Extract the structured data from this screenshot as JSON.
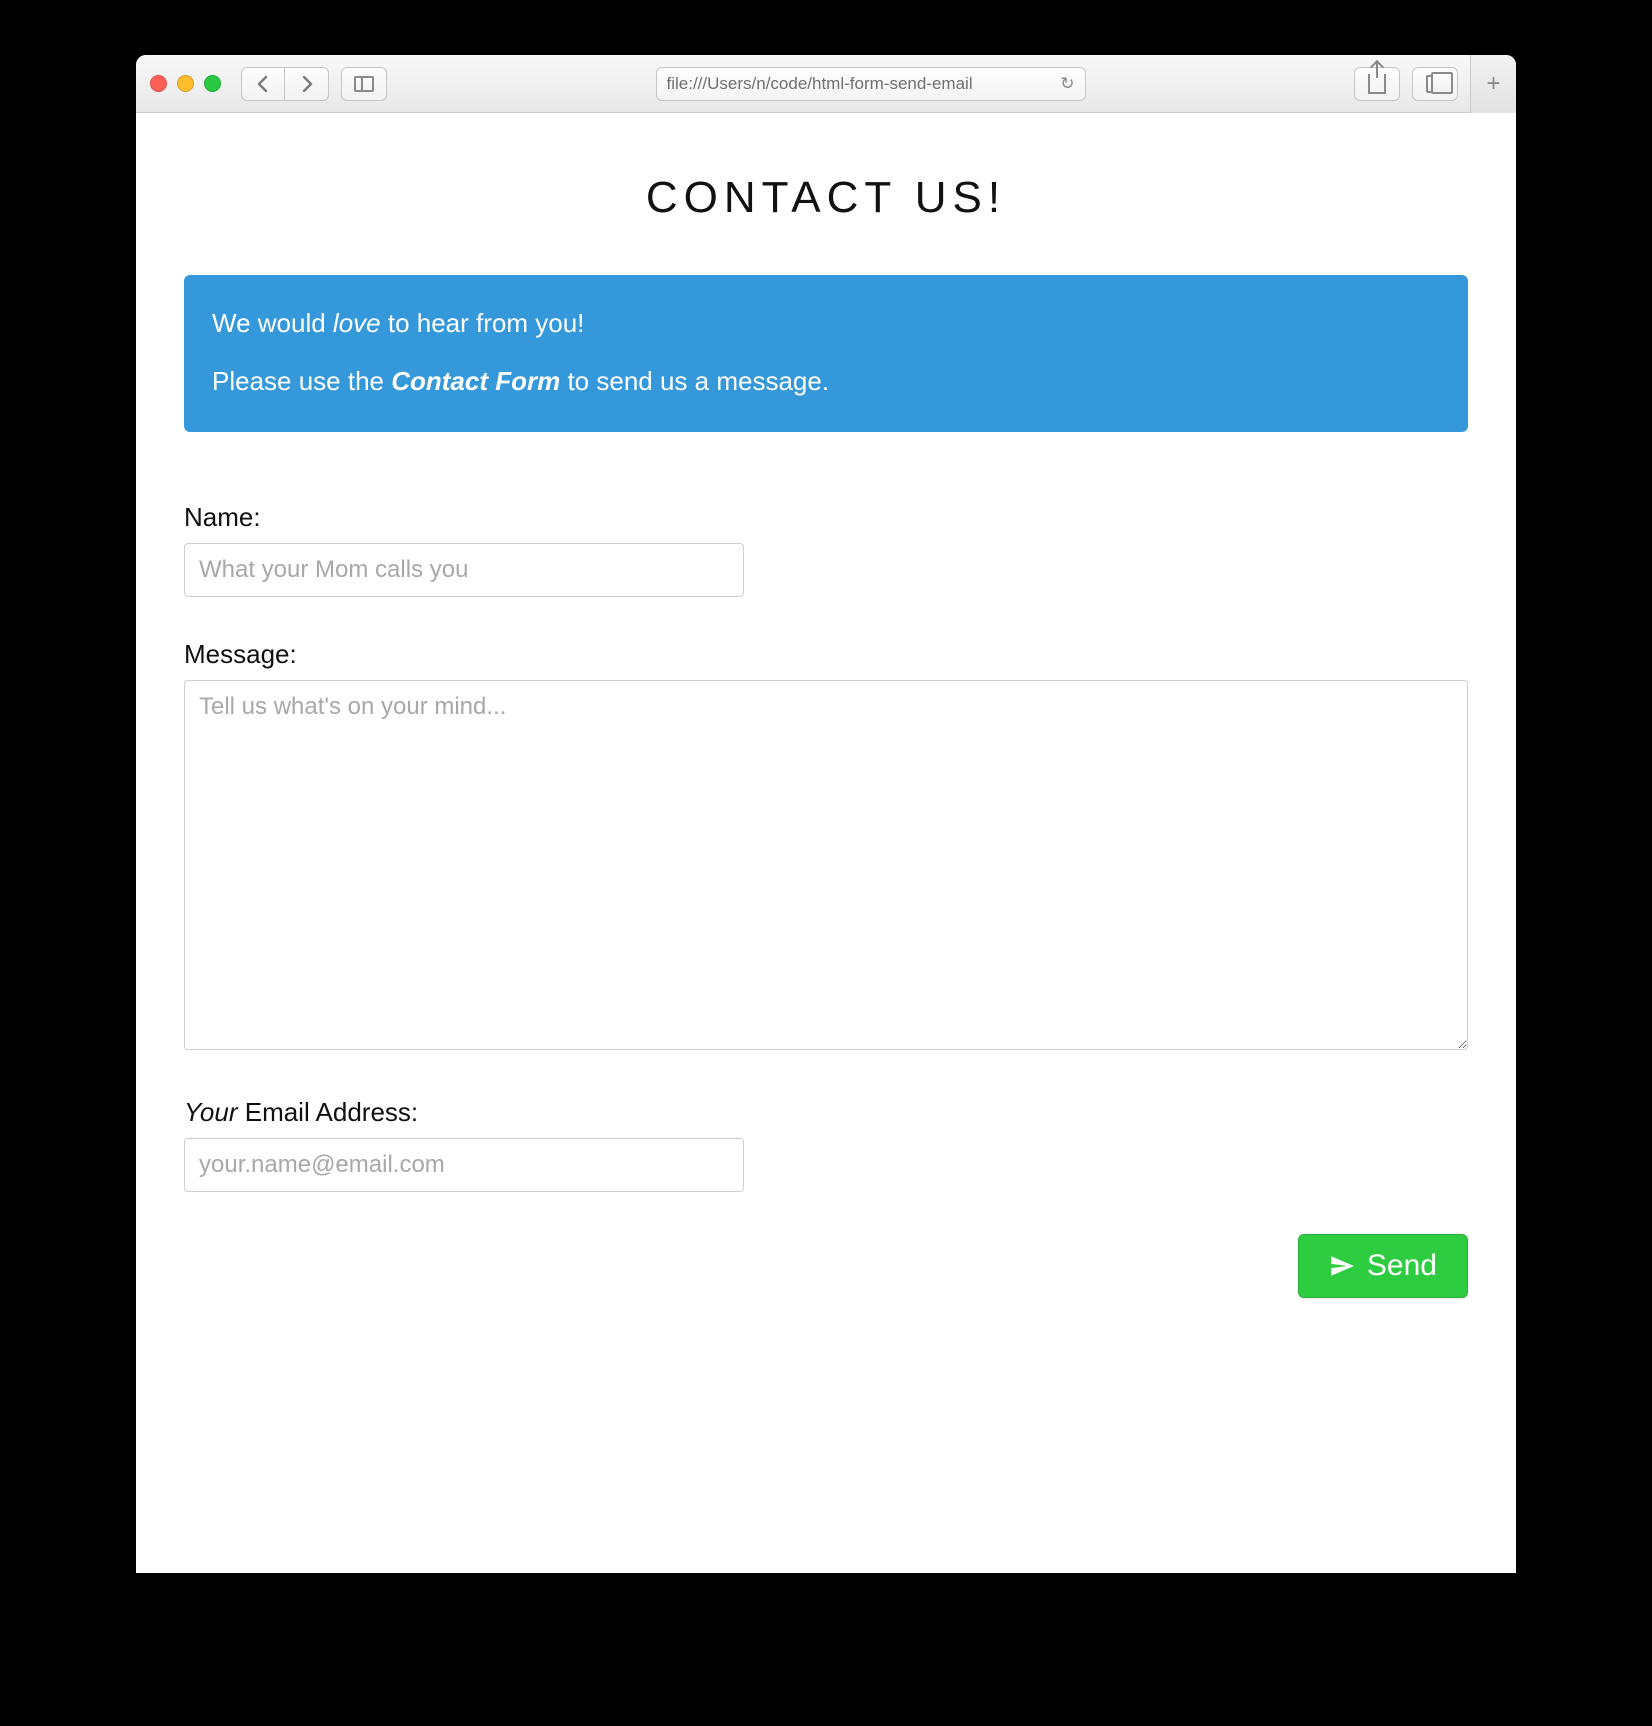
{
  "browser": {
    "url": "file:///Users/n/code/html-form-send-email"
  },
  "page": {
    "title": "CONTACT US!"
  },
  "alert": {
    "line1_pre": "We would ",
    "line1_em": "love",
    "line1_post": " to hear from you!",
    "line2_pre": "Please use the ",
    "line2_strong": "Contact Form",
    "line2_post": " to send us a message."
  },
  "form": {
    "name": {
      "label": "Name:",
      "placeholder": "What your Mom calls you"
    },
    "message": {
      "label": "Message:",
      "placeholder": "Tell us what's on your mind..."
    },
    "email": {
      "label_em": "Your",
      "label_rest": " Email Address:",
      "placeholder": "your.name@email.com"
    },
    "send_label": "Send"
  }
}
